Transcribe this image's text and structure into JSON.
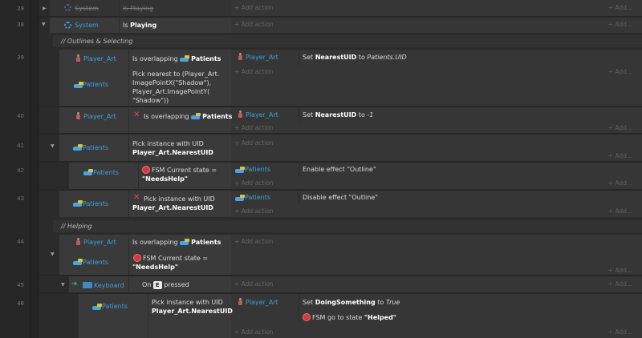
{
  "line_numbers": [
    "29",
    "38",
    "39",
    "40",
    "41",
    "42",
    "43",
    "44",
    "45",
    "46"
  ],
  "add_action": "Add action",
  "add_more": "Add...",
  "rows": {
    "r29": {
      "obj": "System",
      "cond": "Is Playing"
    },
    "r38": {
      "obj": "System",
      "cond_prefix": "Is ",
      "cond_bold": "Playing"
    },
    "c1": "//  Outlines & Selecting",
    "r39": {
      "obj": "Player_Art",
      "cond1_prefix": "Is overlapping ",
      "cond1_obj": "Patients",
      "obj2": "Patients",
      "cond2_l1": "Pick nearest to (Player_Art.",
      "cond2_l2": "ImagePointX(\"Shadow\"),",
      "cond2_l3": "Player_Art.ImagePointY(",
      "cond2_l4": "\"Shadow\"))",
      "act_obj": "Player_Art",
      "act_prefix": "Set ",
      "act_bold": "NearestUID",
      "act_mid": " to ",
      "act_ital": "Patients.UID"
    },
    "r40": {
      "obj": "Player_Art",
      "cond_prefix": "Is overlapping ",
      "cond_obj": "Patients",
      "act_obj": "Player_Art",
      "act_prefix": "Set ",
      "act_bold": "NearestUID",
      "act_mid": " to ",
      "act_ital": "-1"
    },
    "r41": {
      "obj": "Patients",
      "cond_l1": "Pick instance with UID",
      "cond_l2": "Player_Art.NearestUID"
    },
    "r42": {
      "obj": "Patients",
      "cond_l1": "FSM Current state =",
      "cond_l2": "\"NeedsHelp\"",
      "act_obj": "Patients",
      "act_text": "Enable effect \"Outline\""
    },
    "r43": {
      "obj": "Patients",
      "cond_l1": "Pick instance with UID",
      "cond_l2": "Player_Art.NearestUID",
      "act_obj": "Patients",
      "act_text": "Disable effect \"Outline\""
    },
    "c2": "//  Helping",
    "r44": {
      "obj": "Player_Art",
      "cond1_prefix": "Is overlapping ",
      "cond1_obj": "Patients",
      "obj2": "Patients",
      "cond2_l1": "FSM Current state =",
      "cond2_l2": "\"NeedsHelp\""
    },
    "r45": {
      "obj": "Keyboard",
      "cond_prefix": "On ",
      "key": "E",
      "cond_suffix": " pressed"
    },
    "r46": {
      "obj": "Patients",
      "cond_l1": "Pick instance with UID",
      "cond_l2": "Player_Art.NearestUID",
      "act1_obj": "Player_Art",
      "act1_prefix": "Set ",
      "act1_bold": "DoingSomething",
      "act1_mid": " to ",
      "act1_ital": "True",
      "act2_prefix": "FSM go to state ",
      "act2_bold": "\"Helped\""
    }
  }
}
